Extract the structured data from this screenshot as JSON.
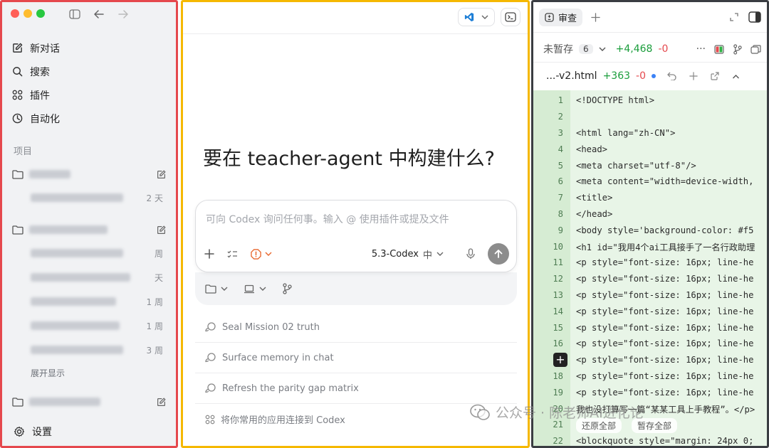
{
  "sidebar": {
    "nav": [
      {
        "label": "新对话",
        "icon": "edit-icon"
      },
      {
        "label": "搜索",
        "icon": "search-icon"
      },
      {
        "label": "插件",
        "icon": "grid-icon"
      },
      {
        "label": "自动化",
        "icon": "clock-icon"
      }
    ],
    "section_label": "项目",
    "conv_ages": [
      "2 天",
      "周",
      "天",
      "1 周",
      "1 周",
      "3 周"
    ],
    "expand_label": "展开显示",
    "settings_label": "设置"
  },
  "middle": {
    "headline": "要在 teacher-agent 中构建什么?",
    "composer_placeholder": "可向 Codex 询问任何事。输入 @ 使用插件或提及文件",
    "model_label": "5.3-Codex",
    "model_tag": "中",
    "suggestions": [
      "Seal Mission 02 truth",
      "Surface memory in chat",
      "Refresh the parity gap matrix",
      "将你常用的应用连接到 Codex"
    ]
  },
  "right": {
    "tab_label": "审查",
    "unsaved_label": "未暂存",
    "unsaved_count": "6",
    "additions": "+4,468",
    "deletions": "-0",
    "file_name": "...-v2.html",
    "file_additions": "+363",
    "file_deletions": "-0",
    "code_lines": [
      {
        "n": "1",
        "t": "<!DOCTYPE html>"
      },
      {
        "n": "2",
        "t": ""
      },
      {
        "n": "3",
        "t": "<html lang=\"zh-CN\">"
      },
      {
        "n": "4",
        "t": "<head>"
      },
      {
        "n": "5",
        "t": "<meta charset=\"utf-8\"/>"
      },
      {
        "n": "6",
        "t": "<meta content=\"width=device-width,"
      },
      {
        "n": "7",
        "t": "<title>"
      },
      {
        "n": "8",
        "t": "</head>"
      },
      {
        "n": "9",
        "t": "<body style='background-color: #f5"
      },
      {
        "n": "10",
        "t": "<h1 id=\"我用4个ai工具接手了一名行政助理"
      },
      {
        "n": "11",
        "t": "<p style=\"font-size: 16px; line-he"
      },
      {
        "n": "12",
        "t": "<p style=\"font-size: 16px; line-he"
      },
      {
        "n": "13",
        "t": "<p style=\"font-size: 16px; line-he"
      },
      {
        "n": "14",
        "t": "<p style=\"font-size: 16px; line-he"
      },
      {
        "n": "15",
        "t": "<p style=\"font-size: 16px; line-he"
      },
      {
        "n": "16",
        "t": "<p style=\"font-size: 16px; line-he"
      },
      {
        "n": "",
        "t": "<p style=\"font-size: 16px; line-he"
      },
      {
        "n": "18",
        "t": "<p style=\"font-size: 16px; line-he"
      },
      {
        "n": "19",
        "t": "<p style=\"font-size: 16px; line-he"
      },
      {
        "n": "20",
        "t": "我也没打算写一篇“某某工具上手教程”。</p>"
      },
      {
        "n": "21",
        "t": ""
      },
      {
        "n": "22",
        "t": "<blockquote style=\"margin: 24px 0;"
      }
    ],
    "float_actions": [
      "还原全部",
      "暂存全部"
    ]
  },
  "watermark": "公众号 · 陈老师AI进化论"
}
